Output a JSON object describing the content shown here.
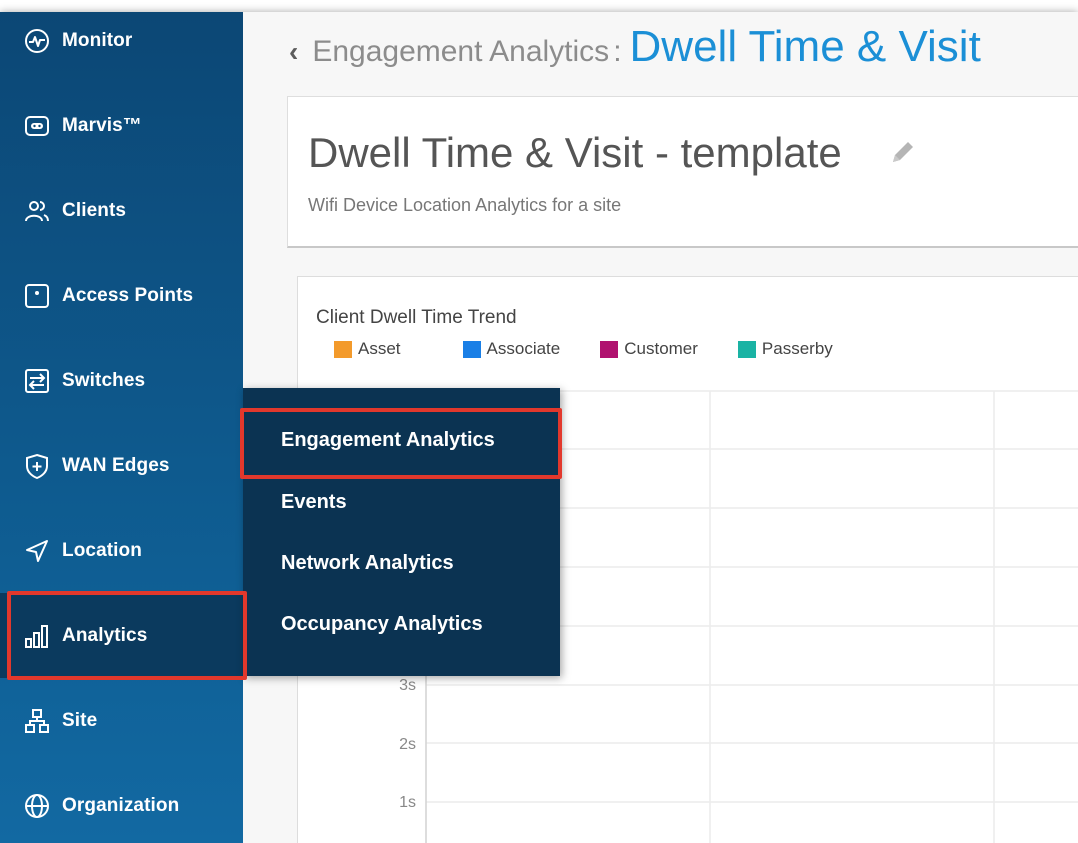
{
  "sidebar": {
    "items": [
      {
        "label": "Monitor",
        "icon": "monitor-icon"
      },
      {
        "label": "Marvis™",
        "icon": "marvis-icon"
      },
      {
        "label": "Clients",
        "icon": "clients-icon"
      },
      {
        "label": "Access Points",
        "icon": "access-point-icon"
      },
      {
        "label": "Switches",
        "icon": "switch-icon"
      },
      {
        "label": "WAN Edges",
        "icon": "wan-edge-shield-icon"
      },
      {
        "label": "Location",
        "icon": "location-arrow-icon"
      },
      {
        "label": "Analytics",
        "icon": "analytics-bars-icon"
      },
      {
        "label": "Site",
        "icon": "site-icon"
      },
      {
        "label": "Organization",
        "icon": "globe-icon"
      }
    ],
    "active": "Analytics"
  },
  "flyout": {
    "items": [
      {
        "label": "Engagement Analytics"
      },
      {
        "label": "Events"
      },
      {
        "label": "Network Analytics"
      },
      {
        "label": "Occupancy Analytics"
      }
    ]
  },
  "breadcrumb": {
    "back_icon": "chevron-left-icon",
    "parent": "Engagement Analytics",
    "separator": ":",
    "current": "Dwell Time & Visit"
  },
  "header": {
    "title": "Dwell Time & Visit - template",
    "subtitle": "Wifi Device Location Analytics for a site",
    "edit_icon": "pencil-icon"
  },
  "colors": {
    "sidebar": "#0e5a8e",
    "flyout": "#0b3352",
    "highlight": "#e2382c",
    "accent": "#1b8fd6"
  },
  "chart_data": {
    "type": "line",
    "title": "Client Dwell Time Trend",
    "series": [
      {
        "name": "Asset",
        "color": "#f39a2b",
        "values": []
      },
      {
        "name": "Associate",
        "color": "#1a7fe6",
        "values": []
      },
      {
        "name": "Customer",
        "color": "#b0126f",
        "values": []
      },
      {
        "name": "Passerby",
        "color": "#1ab3a4",
        "values": []
      }
    ],
    "y_ticks": [
      "3s",
      "2s",
      "1s"
    ],
    "grid": true
  }
}
